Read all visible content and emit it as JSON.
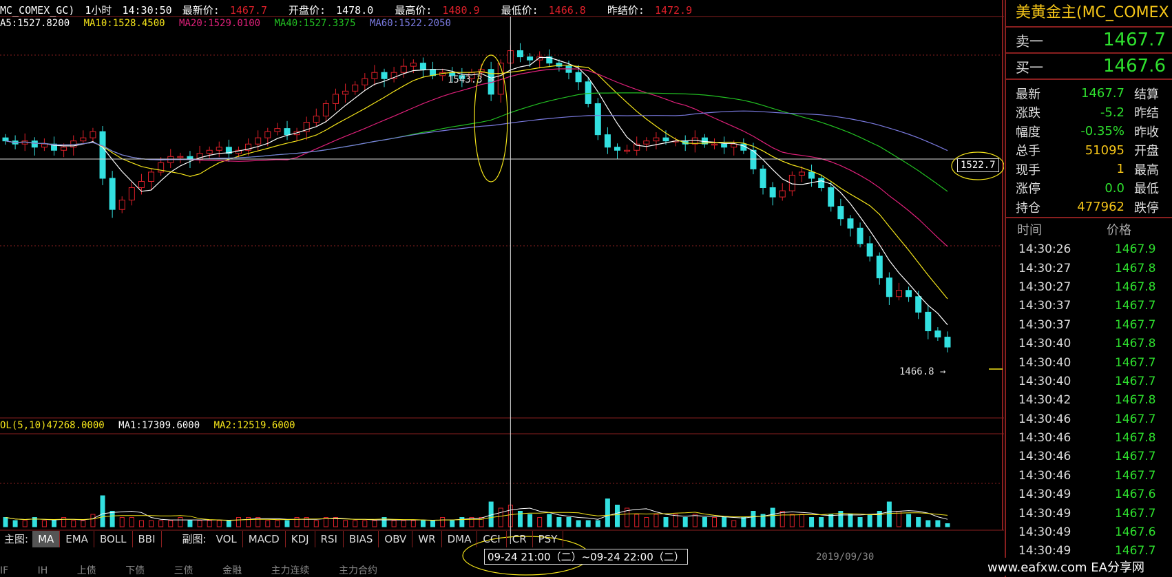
{
  "header": {
    "symbol": "MC_COMEX_GC)",
    "period": "1小时",
    "time": "14:30:50",
    "last_label": "最新价:",
    "last": "1467.7",
    "open_label": "开盘价:",
    "open": "1478.0",
    "high_label": "最高价:",
    "high": "1480.9",
    "low_label": "最低价:",
    "low": "1466.8",
    "prev_label": "昨结价:",
    "prev": "1472.9"
  },
  "ma_legend": {
    "ma5": "A5:1527.8200",
    "ma10": "MA10:1528.4500",
    "ma20": "MA20:1529.0100",
    "ma40": "MA40:1527.3375",
    "ma60": "MA60:1522.2050"
  },
  "vol_legend": {
    "vol": "OL(5,10)47268.0000",
    "ma1": "MA1:17309.6000",
    "ma2": "MA2:12519.6000"
  },
  "annotations": {
    "high_marker": "1543.3",
    "low_marker": "1466.8",
    "crosshair_price": "1522.7",
    "timeline": "09-24  21:00（二）~09-24  22:00（二）",
    "date": "2019/09/30"
  },
  "tabbar": {
    "main_label": "主图:",
    "main_tabs": [
      "MA",
      "EMA",
      "BOLL",
      "BBI"
    ],
    "sub_label": "副图:",
    "sub_tabs": [
      "VOL",
      "MACD",
      "KDJ",
      "RSI",
      "BIAS",
      "OBV",
      "WR",
      "DMA",
      "CCI",
      "CR",
      "PSY"
    ],
    "active": "MA"
  },
  "bottom_tabs": [
    "IF",
    "IH",
    "上债",
    "下债",
    "三债",
    "金融",
    "主力连续",
    "主力合约"
  ],
  "panel": {
    "title": "美黄金主(MC_COMEX",
    "sell_label": "卖一",
    "sell": "1467.7",
    "buy_label": "买一",
    "buy": "1467.6",
    "quote": [
      {
        "k": "最新",
        "v": "1467.7",
        "color": "#2ee02e",
        "k2": "结算"
      },
      {
        "k": "涨跌",
        "v": "-5.2",
        "color": "#2ee02e",
        "k2": "昨结"
      },
      {
        "k": "幅度",
        "v": "-0.35%",
        "color": "#2ee02e",
        "k2": "昨收"
      },
      {
        "k": "总手",
        "v": "51095",
        "color": "#f5c518",
        "k2": "开盘"
      },
      {
        "k": "现手",
        "v": "1",
        "color": "#f5c518",
        "k2": "最高"
      },
      {
        "k": "涨停",
        "v": "0.0",
        "color": "#2ee02e",
        "k2": "最低"
      },
      {
        "k": "持仓",
        "v": "477962",
        "color": "#f5c518",
        "k2": "跌停"
      }
    ],
    "ticks_head_time": "时间",
    "ticks_head_price": "价格",
    "ticks": [
      {
        "t": "14:30:26",
        "p": "1467.9"
      },
      {
        "t": "14:30:27",
        "p": "1467.8"
      },
      {
        "t": "14:30:27",
        "p": "1467.8"
      },
      {
        "t": "14:30:37",
        "p": "1467.7"
      },
      {
        "t": "14:30:37",
        "p": "1467.7"
      },
      {
        "t": "14:30:40",
        "p": "1467.8"
      },
      {
        "t": "14:30:40",
        "p": "1467.7"
      },
      {
        "t": "14:30:40",
        "p": "1467.7"
      },
      {
        "t": "14:30:42",
        "p": "1467.8"
      },
      {
        "t": "14:30:46",
        "p": "1467.7"
      },
      {
        "t": "14:30:46",
        "p": "1467.8"
      },
      {
        "t": "14:30:46",
        "p": "1467.7"
      },
      {
        "t": "14:30:46",
        "p": "1467.7"
      },
      {
        "t": "14:30:49",
        "p": "1467.6"
      },
      {
        "t": "14:30:49",
        "p": "1467.7"
      },
      {
        "t": "14:30:49",
        "p": "1467.6"
      },
      {
        "t": "14:30:49",
        "p": "1467.7"
      }
    ]
  },
  "watermark": "www.eafxw.com   EA分享网",
  "colors": {
    "up": "#e0202a",
    "down": "#33e0e0",
    "ma5": "#ffffff",
    "ma10": "#f5e51a",
    "ma20": "#e0207a",
    "ma40": "#22c022",
    "ma60": "#7a7ae0",
    "grid": "#8a1f1f"
  },
  "chart_data": {
    "type": "candlestick",
    "ylim": [
      1450,
      1565
    ],
    "closes": [
      1533,
      1532,
      1533,
      1531,
      1532,
      1530,
      1531,
      1533,
      1534,
      1536,
      1521,
      1511,
      1514,
      1518,
      1520,
      1523,
      1526,
      1528,
      1528,
      1527,
      1529,
      1530,
      1531,
      1529,
      1530,
      1532,
      1534,
      1536,
      1537,
      1535,
      1536,
      1539,
      1541,
      1545,
      1548,
      1549,
      1551,
      1553,
      1555,
      1553,
      1555,
      1557,
      1558,
      1556,
      1554,
      1555,
      1554,
      1553,
      1555,
      1556,
      1548,
      1558,
      1562,
      1560,
      1559,
      1560,
      1558,
      1557,
      1555,
      1552,
      1545,
      1535,
      1531,
      1530,
      1530,
      1532,
      1533,
      1534,
      1533,
      1533,
      1532,
      1534,
      1532,
      1532,
      1531,
      1532,
      1530,
      1524,
      1518,
      1515,
      1517,
      1522,
      1523,
      1521,
      1518,
      1512,
      1508,
      1505,
      1500,
      1496,
      1489,
      1483,
      1485,
      1483,
      1478,
      1472,
      1470,
      1466.8
    ],
    "volumes": [
      3,
      2,
      2,
      3,
      2,
      2,
      3,
      2,
      2,
      4,
      10,
      5,
      3,
      3,
      2,
      2,
      2,
      2,
      3,
      2,
      2,
      2,
      2,
      2,
      3,
      3,
      3,
      2,
      2,
      2,
      3,
      3,
      2,
      3,
      3,
      2,
      2,
      2,
      2,
      3,
      2,
      2,
      2,
      2,
      2,
      3,
      2,
      3,
      3,
      3,
      8,
      6,
      7,
      5,
      4,
      3,
      4,
      3,
      3,
      2,
      2,
      2,
      9,
      7,
      6,
      4,
      3,
      4,
      3,
      4,
      3,
      4,
      3,
      3,
      3,
      2,
      3,
      5,
      4,
      6,
      5,
      4,
      4,
      3,
      3,
      4,
      5,
      4,
      3,
      4,
      5,
      8,
      5,
      4,
      3,
      2,
      2,
      1
    ],
    "volume_unit": "relative",
    "ma_labels": [
      "MA5",
      "MA10",
      "MA20",
      "MA40",
      "MA60"
    ]
  }
}
